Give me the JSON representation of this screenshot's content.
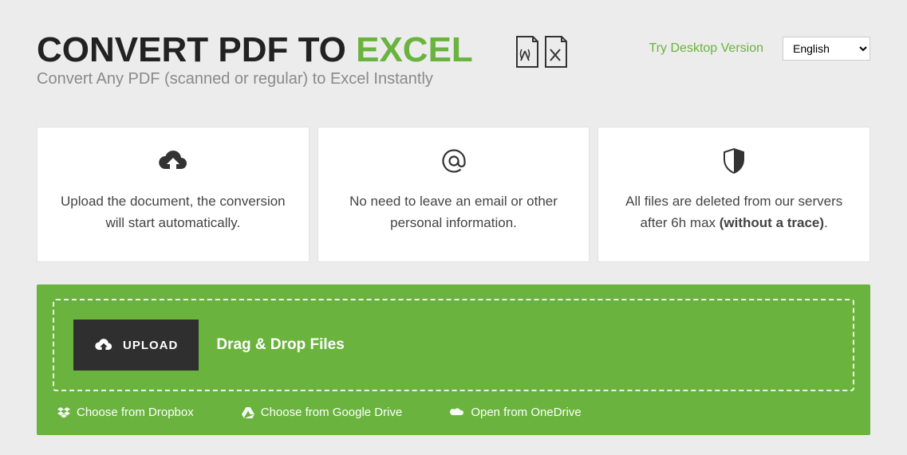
{
  "header": {
    "title_part1": "CONVERT PDF TO ",
    "title_part2": "EXCEL",
    "subtitle": "Convert Any PDF (scanned or regular) to Excel Instantly",
    "try_link": "Try Desktop Version",
    "language": "English"
  },
  "features": [
    {
      "text": "Upload the document, the conversion will start automatically."
    },
    {
      "text": "No need to leave an email or other personal information."
    },
    {
      "text_prefix": "All files are deleted from our servers after 6h max ",
      "text_bold": "(without a trace)",
      "text_suffix": "."
    }
  ],
  "upload": {
    "button": "UPLOAD",
    "drag_label": "Drag & Drop Files",
    "dropbox": "Choose from Dropbox",
    "gdrive": "Choose from Google Drive",
    "onedrive": "Open from OneDrive"
  }
}
